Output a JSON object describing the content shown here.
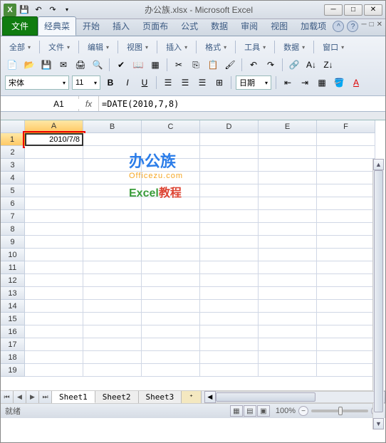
{
  "title": "办公族.xlsx - Microsoft Excel",
  "tabs": {
    "file": "文件",
    "classic": "经典菜",
    "items": [
      "开始",
      "插入",
      "页面布",
      "公式",
      "数据",
      "审阅",
      "视图",
      "加载项"
    ]
  },
  "ribbon_menus": [
    "全部",
    "文件",
    "编辑",
    "视图",
    "插入",
    "格式",
    "工具",
    "数据",
    "窗口"
  ],
  "font": {
    "name": "宋体",
    "size": "11",
    "date_label": "日期"
  },
  "name_box": "A1",
  "fx_label": "fx",
  "formula": "=DATE(2010,7,8)",
  "columns": [
    "A",
    "B",
    "C",
    "D",
    "E",
    "F"
  ],
  "row_count": 19,
  "selected_cell": {
    "col": "A",
    "row": 1,
    "value": "2010/7/8"
  },
  "watermark": {
    "line1": "办公族",
    "line2": "Officezu.com",
    "line3a": "Excel",
    "line3b": "教程"
  },
  "sheets": [
    "Sheet1",
    "Sheet2",
    "Sheet3"
  ],
  "active_sheet": 0,
  "status": {
    "ready": "就绪",
    "zoom": "100%"
  }
}
